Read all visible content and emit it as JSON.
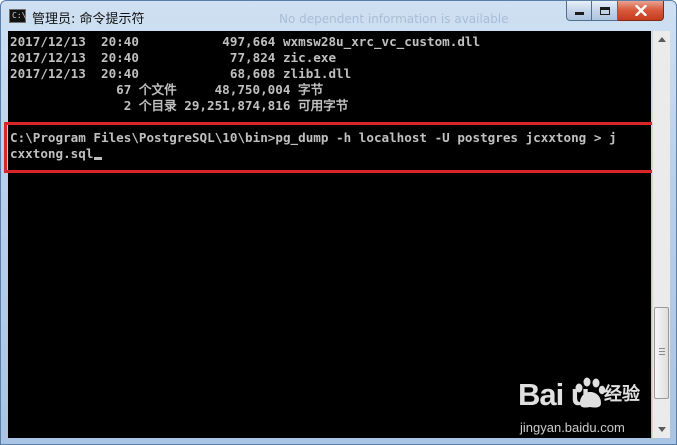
{
  "window": {
    "title": "管理员: 命令提示符",
    "icon_label": "C:\\",
    "ghost_text": "No dependent information is available"
  },
  "console": {
    "lines": [
      "2017/12/13  20:40           497,664 wxmsw28u_xrc_vc_custom.dll",
      "2017/12/13  20:40            77,824 zic.exe",
      "2017/12/13  20:40            68,608 zlib1.dll",
      "              67 个文件     48,750,004 字节",
      "               2 个目录 29,251,874,816 可用字节",
      "",
      "C:\\Program Files\\PostgreSQL\\10\\bin>pg_dump -h localhost -U postgres jcxxtong > j",
      "cxxtong.sql"
    ],
    "text_color": "#c0c0c0",
    "background": "#000000"
  },
  "highlight_color": "#d9262c",
  "watermark": {
    "logo": "Bai  u",
    "sub": "经验",
    "url": "jingyan.baidu.com"
  }
}
